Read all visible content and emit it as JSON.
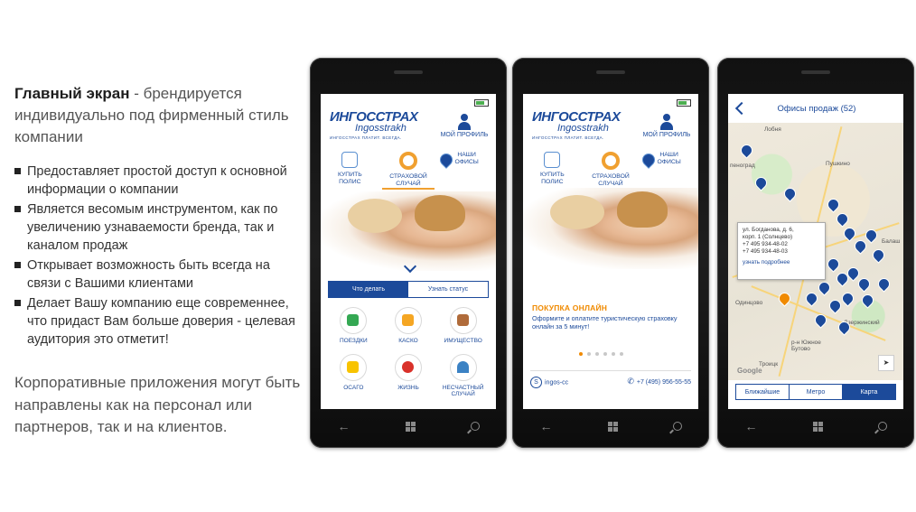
{
  "left": {
    "lead_bold": "Главный экран",
    "lead_rest": " - брендируется индивидуально под фирменный стиль компании",
    "bullets": [
      "Предоставляет простой доступ к основной информации о компании",
      "Является весомым инструментом, как по увеличению узнаваемости бренда, так и каналом продаж",
      "Открывает возможность быть всегда на связи с Вашими клиентами",
      "Делает Вашу компанию еще современнее, что придаст Вам больше доверия - целевая аудитория это отметит!"
    ],
    "corporate": "Корпоративные приложения могут быть направлены как на персонал или партнеров, так и на клиентов."
  },
  "app": {
    "logo_main": "ИНГОССТРАХ",
    "logo_script": "Ingosstrakh",
    "logo_tagline": "ИНГОССТРАХ ПЛАТИТ. ВСЕГДА.",
    "profile": "МОЙ ПРОФИЛЬ",
    "menu": [
      {
        "line1": "КУПИТЬ",
        "line2": "ПОЛИС"
      },
      {
        "line1": "СТРАХОВОЙ",
        "line2": "СЛУЧАЙ"
      },
      {
        "line1": "НАШИ",
        "line2": "ОФИСЫ"
      }
    ]
  },
  "screen1": {
    "seg_left": "Что делать",
    "seg_right": "Узнать статус",
    "grid": [
      {
        "label1": "ПОЕЗДКИ",
        "label2": ""
      },
      {
        "label1": "КАСКО",
        "label2": ""
      },
      {
        "label1": "ИМУЩЕСТВО",
        "label2": ""
      },
      {
        "label1": "ОСАГО",
        "label2": ""
      },
      {
        "label1": "ЖИЗНЬ",
        "label2": ""
      },
      {
        "label1": "НЕСЧАСТНЫЙ",
        "label2": "СЛУЧАЙ"
      }
    ]
  },
  "screen2": {
    "promo_title": "ПОКУПКА ОНЛАЙН",
    "promo_text": "Оформите и оплатите туристическую страховку онлайн за 5 минут!",
    "skype": "ingos-cc",
    "phone": "+7 (495) 956-55-55"
  },
  "screen3": {
    "title": "Офисы продаж (52)",
    "popup_addr1": "ул. Богданова, д. 6,",
    "popup_addr2": "корп. 1 (Солнцево)",
    "popup_phone1": "+7 495 934-48-02",
    "popup_phone2": "+7 495 934-48-03",
    "popup_more": "узнать подробнее",
    "places": [
      "Пушкино",
      "Балаш",
      "Одинцово",
      "р-н Южное Бутово",
      "Дзержинский",
      "Троицк",
      "пеноград",
      "Лобня"
    ],
    "tabs": [
      "Ближайшие",
      "Метро",
      "Карта"
    ],
    "google": "Google"
  },
  "colors": {
    "brand": "#1c4a9a",
    "accent": "#f08a00"
  }
}
